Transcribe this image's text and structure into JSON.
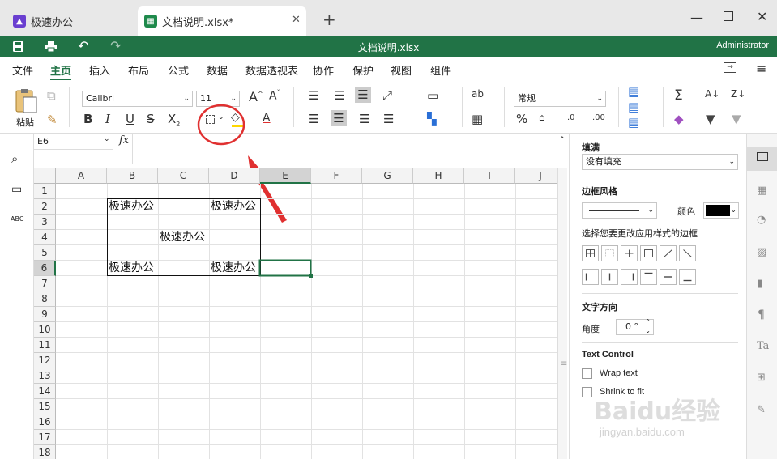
{
  "tabs": [
    {
      "label": "极速办公",
      "active": false
    },
    {
      "label": "文档说明.xlsx*",
      "active": true
    }
  ],
  "titlebar": {
    "title": "文档说明.xlsx",
    "user": "Administrator"
  },
  "menu": [
    "文件",
    "主页",
    "插入",
    "布局",
    "公式",
    "数据",
    "数据透视表",
    "协作",
    "保护",
    "视图",
    "组件"
  ],
  "ribbon": {
    "paste_label": "粘贴",
    "font_name": "Calibri",
    "font_size": "11",
    "number_format": "常规"
  },
  "formula": {
    "name_box": "E6",
    "fx": "fx"
  },
  "columns": [
    "A",
    "B",
    "C",
    "D",
    "E",
    "F",
    "G",
    "H",
    "I",
    "J"
  ],
  "rows": [
    "1",
    "2",
    "3",
    "4",
    "5",
    "6",
    "7",
    "8",
    "9",
    "10",
    "11",
    "12",
    "13",
    "14",
    "15",
    "16",
    "17",
    "18"
  ],
  "cells": {
    "b2": "极速办公",
    "d2": "极速办公",
    "c4": "极速办公",
    "b6": "极速办公",
    "d6": "极速办公"
  },
  "panel": {
    "fill_title": "填满",
    "fill_value": "没有填充",
    "border_title": "边框风格",
    "color_label": "颜色",
    "border_hint": "选择您要更改应用样式的边框",
    "text_dir_title": "文字方向",
    "angle_label": "角度",
    "angle_value": "0 °",
    "text_control_title": "Text Control",
    "wrap_text": "Wrap text",
    "shrink": "Shrink to fit"
  },
  "watermark": {
    "brand": "Baidu经验",
    "url": "jingyan.baidu.com"
  },
  "colors": {
    "green": "#217346",
    "annotation_red": "#e03030",
    "active_tab_icon": "#1f8a4c",
    "app_icon": "#6a3fd0"
  }
}
